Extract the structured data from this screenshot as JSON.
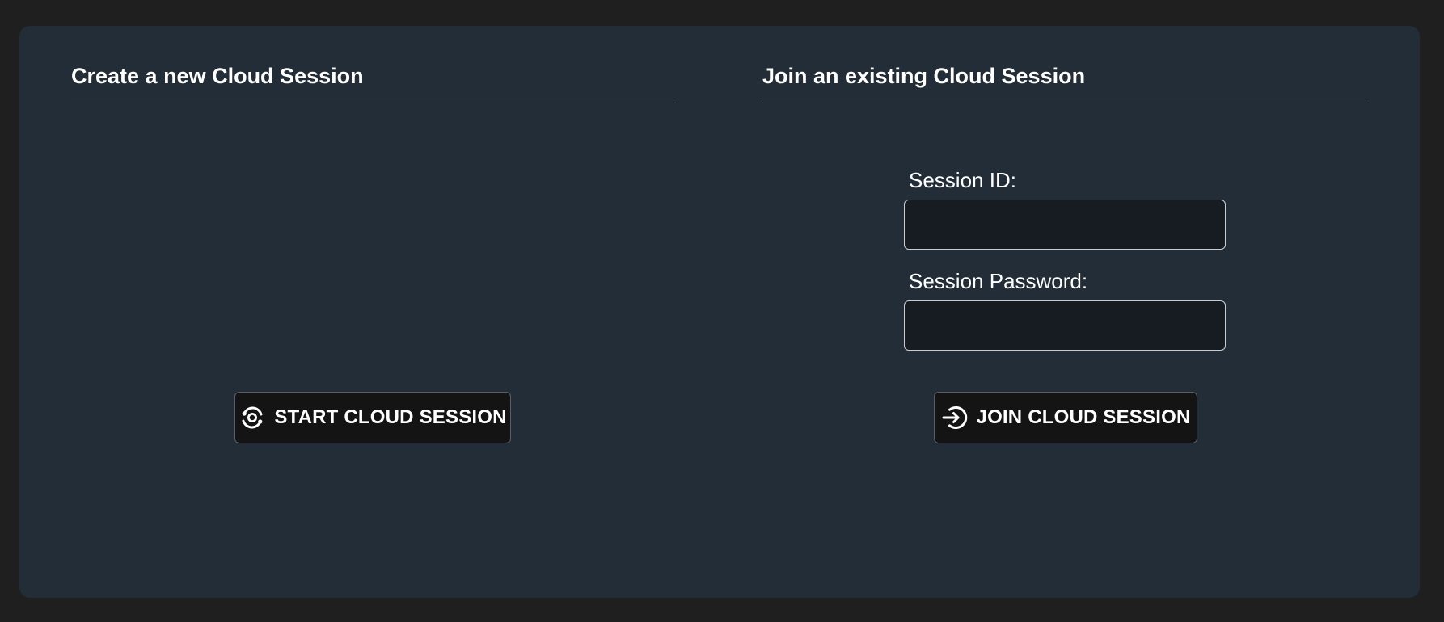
{
  "create_section": {
    "title": "Create a new Cloud Session",
    "start_button": {
      "label": "START CLOUD SESSION",
      "icon": "cloud-sync-icon"
    }
  },
  "join_section": {
    "title": "Join an existing Cloud Session",
    "session_id": {
      "label": "Session ID:",
      "value": "",
      "placeholder": ""
    },
    "session_password": {
      "label": "Session Password:",
      "value": "",
      "placeholder": ""
    },
    "join_button": {
      "label": "JOIN CLOUD SESSION",
      "icon": "sign-in-arrow-icon"
    }
  },
  "colors": {
    "page_background": "#1f1f1f",
    "card_background": "#232d38",
    "input_background": "#171b22",
    "button_background": "#141414",
    "text": "#ffffff",
    "divider": "#6a737d"
  }
}
